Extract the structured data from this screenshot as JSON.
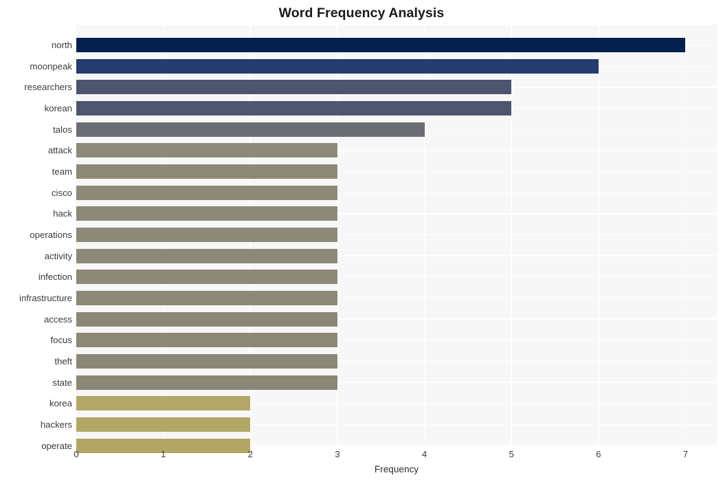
{
  "chart_data": {
    "type": "bar",
    "orientation": "horizontal",
    "title": "Word Frequency Analysis",
    "xlabel": "Frequency",
    "ylabel": "",
    "xlim": [
      0,
      7.36
    ],
    "xticks": [
      0,
      1,
      2,
      3,
      4,
      5,
      6,
      7
    ],
    "xtick_labels": [
      "0",
      "1",
      "2",
      "3",
      "4",
      "5",
      "6",
      "7"
    ],
    "grid": true,
    "legend": false,
    "categories": [
      "north",
      "moonpeak",
      "researchers",
      "korean",
      "talos",
      "attack",
      "team",
      "cisco",
      "hack",
      "operations",
      "activity",
      "infection",
      "infrastructure",
      "access",
      "focus",
      "theft",
      "state",
      "korea",
      "hackers",
      "operate"
    ],
    "values": [
      7,
      6,
      5,
      5,
      4,
      3,
      3,
      3,
      3,
      3,
      3,
      3,
      3,
      3,
      3,
      3,
      3,
      2,
      2,
      2
    ],
    "bar_colors": [
      "#03204c",
      "#263c6e",
      "#4c546e",
      "#4e566f",
      "#6b6d75",
      "#8e8a7b",
      "#8d8979",
      "#8d8979",
      "#8d8979",
      "#8d8979",
      "#8d8979",
      "#8d8979",
      "#8c8878",
      "#8c8878",
      "#8c8878",
      "#8c8878",
      "#8b8777",
      "#b2a767",
      "#b2a767",
      "#b1a666"
    ],
    "plot_background": "#f7f7f7",
    "gridline_color": "#ffffff",
    "title_color": "#1a1a1a",
    "tick_label_color": "#3b3b3b"
  }
}
